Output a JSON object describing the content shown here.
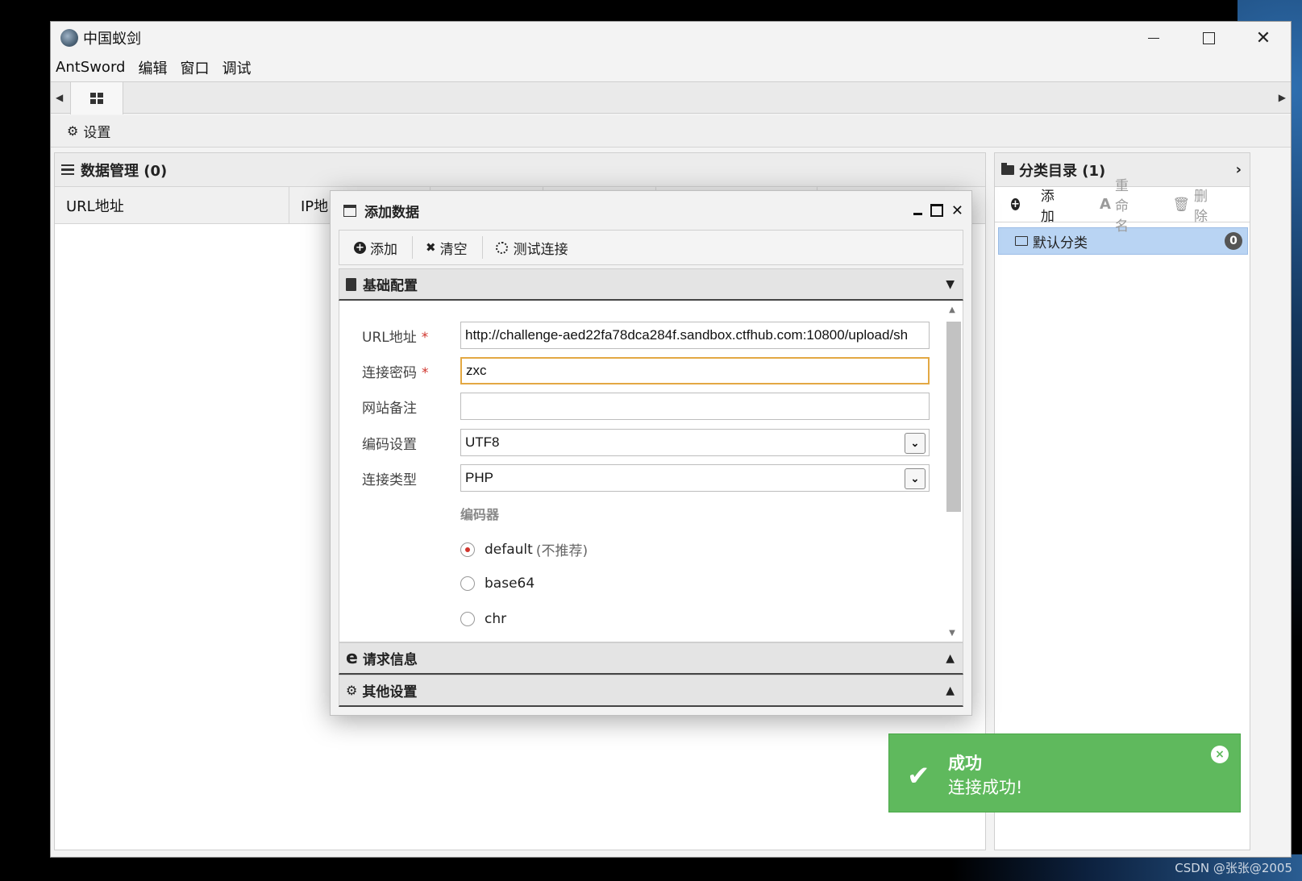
{
  "window": {
    "title": "中国蚁剑",
    "controls": {
      "minimize": "",
      "maximize": "",
      "close": "✕"
    }
  },
  "menu": [
    "AntSword",
    "编辑",
    "窗口",
    "调试"
  ],
  "settings_bar": {
    "label": "设置"
  },
  "data_panel": {
    "title": "数据管理 (0)",
    "columns": [
      "URL地址",
      "IP地"
    ]
  },
  "category_panel": {
    "title": "分类目录 (1)",
    "toolbar": {
      "add": "添加",
      "rename": "重命名",
      "delete": "删除"
    },
    "items": [
      {
        "label": "默认分类",
        "count": "0"
      }
    ]
  },
  "dialog": {
    "title": "添加数据",
    "toolbar": {
      "add": "添加",
      "clear": "清空",
      "test": "测试连接"
    },
    "sections": {
      "basic": "基础配置",
      "request": "请求信息",
      "other": "其他设置"
    },
    "fields": {
      "url": {
        "label": "URL地址",
        "required": "*",
        "value": "http://challenge-aed22fa78dca284f.sandbox.ctfhub.com:10800/upload/sh"
      },
      "password": {
        "label": "连接密码",
        "required": "*",
        "value": "zxc"
      },
      "note": {
        "label": "网站备注",
        "value": ""
      },
      "encoding": {
        "label": "编码设置",
        "value": "UTF8"
      },
      "type": {
        "label": "连接类型",
        "value": "PHP"
      }
    },
    "encoder": {
      "title": "编码器",
      "options": [
        {
          "label": "default",
          "hint": "(不推荐)",
          "checked": true
        },
        {
          "label": "base64",
          "checked": false
        },
        {
          "label": "chr",
          "checked": false
        }
      ]
    }
  },
  "toast": {
    "title": "成功",
    "message": "连接成功!",
    "color": "#5fb95d"
  },
  "watermark": "CSDN @张张@2005"
}
